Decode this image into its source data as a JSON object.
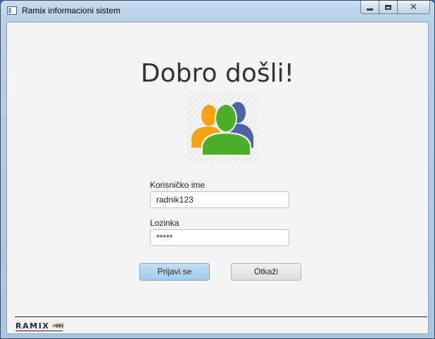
{
  "window": {
    "title": "Ramix informacioni sistem",
    "controls": {
      "minimize_icon": "minimize-icon",
      "maximize_icon": "maximize-icon",
      "close_icon": "close-icon",
      "close_glyph": "✕"
    }
  },
  "login": {
    "heading": "Dobro došli!",
    "illustration_icon": "users-group-icon",
    "username": {
      "label": "Korisničko ime",
      "value": "radnik123"
    },
    "password": {
      "label": "Lozinka",
      "value": "*****"
    },
    "buttons": {
      "login": "Prijavi se",
      "cancel": "Otkaži"
    }
  },
  "footer": {
    "brand": "RAMIX",
    "brand_arrow_colors": [
      "#f2b21b",
      "#2e7fd0",
      "#d33b2c",
      "#3aa53a"
    ]
  },
  "colors": {
    "primary_button": "#a4cbe8",
    "user_orange": "#f5a30f",
    "user_green": "#4caf2a",
    "user_blue": "#4c63a6"
  }
}
